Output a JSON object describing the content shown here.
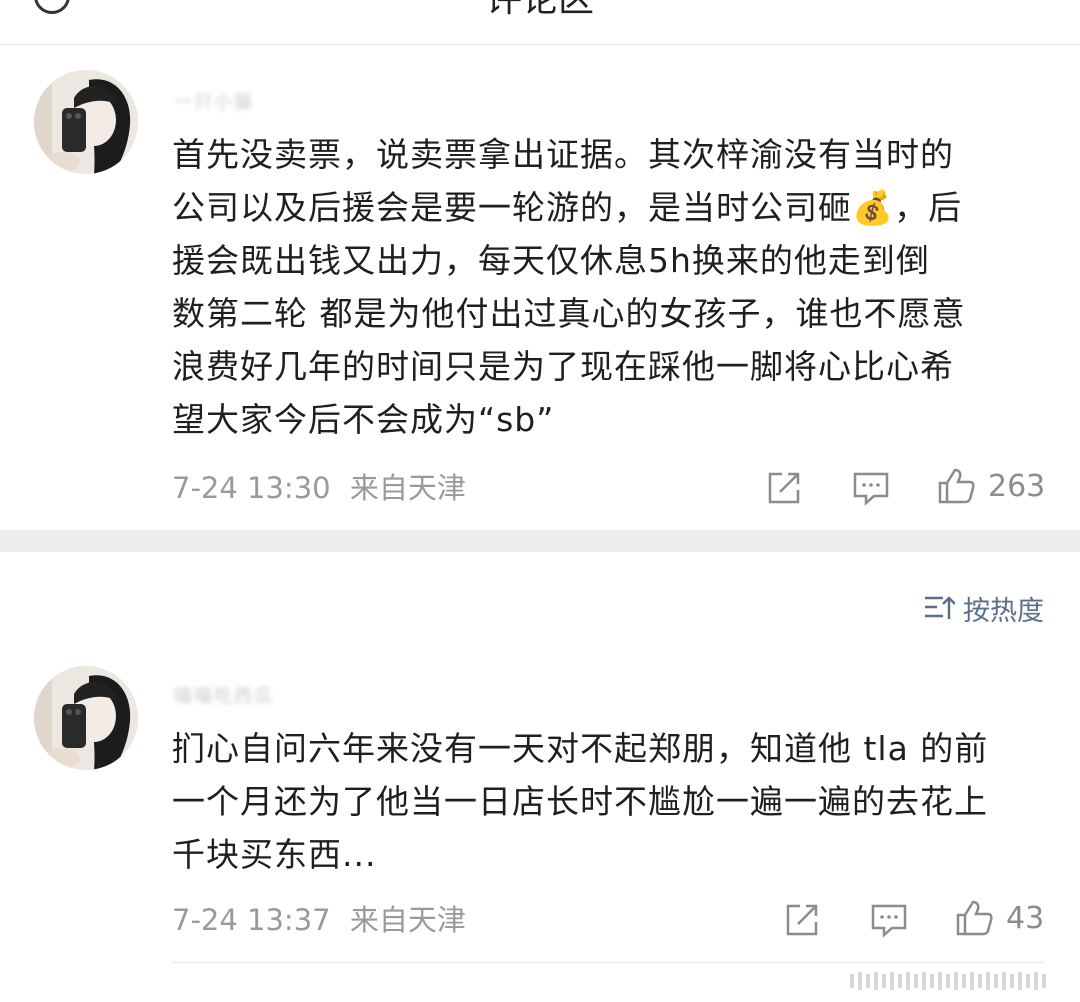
{
  "header": {
    "title": "评论区"
  },
  "comments": [
    {
      "username": "一只小猫",
      "text": "首先没卖票，说卖票拿出证据。其次梓渝没有当时的\n公司以及后援会是要一轮游的，是当时公司砸💰，后\n援会既出钱又出力，每天仅休息5h换来的他走到倒\n数第二轮 都是为他付出过真心的女孩子，谁也不愿意\n浪费好几年的时间只是为了现在踩他一脚将心比心希\n望大家今后不会成为“sb”",
      "time": "7-24 13:30",
      "location": "来自天津",
      "likes": "263"
    },
    {
      "username": "喵喵吃西瓜",
      "text": "扪心自问六年来没有一天对不起郑朋，知道他 tla 的前\n一个月还为了他当一日店长时不尴尬一遍一遍的去花上\n千块买东西...",
      "time": "7-24 13:37",
      "location": "来自天津",
      "likes": "43"
    }
  ],
  "sort": {
    "label": "按热度"
  },
  "colors": {
    "text": "#1f1f1f",
    "meta": "#9a9a9a",
    "sort": "#5b6f8a",
    "band": "#eeeeee"
  }
}
